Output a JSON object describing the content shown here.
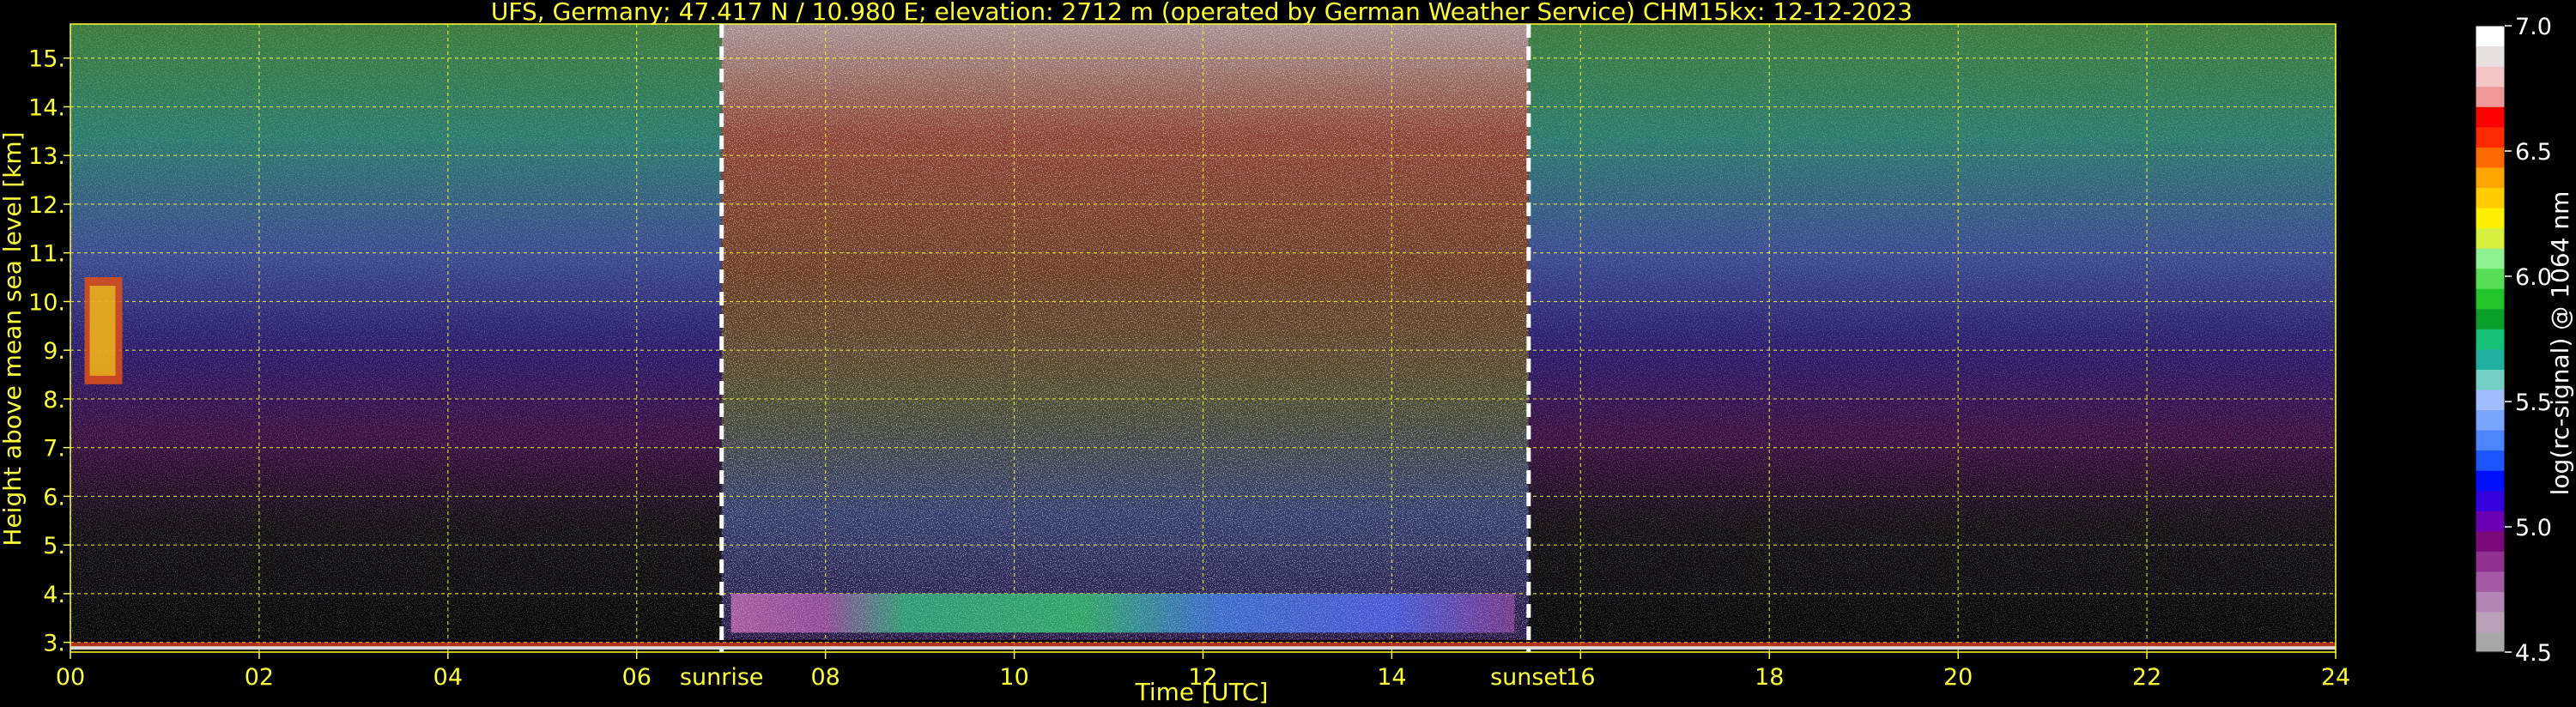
{
  "chart_data": {
    "type": "heatmap",
    "title": "UFS, Germany; 47.417 N / 10.980 E; elevation: 2712 m  (operated by German Weather Service)    CHM15kx: 12-12-2023",
    "xlabel": "Time [UTC]",
    "ylabel": "Height above mean sea level [km]",
    "xlim": [
      0,
      24
    ],
    "ylim": [
      2.8,
      15.7
    ],
    "x_ticks": [
      0,
      2,
      4,
      6,
      8,
      10,
      12,
      14,
      16,
      18,
      20,
      22,
      24
    ],
    "x_tick_labels": [
      "00",
      "02",
      "04",
      "06",
      "08",
      "10",
      "12",
      "14",
      "16",
      "18",
      "20",
      "22",
      "24"
    ],
    "y_ticks": [
      3,
      4,
      5,
      6,
      7,
      8,
      9,
      10,
      11,
      12,
      13,
      14,
      15
    ],
    "y_tick_labels": [
      "3.",
      "4.",
      "5.",
      "6.",
      "7.",
      "8.",
      "9.",
      "10.",
      "11.",
      "12.",
      "13.",
      "14.",
      "15."
    ],
    "grid": true,
    "grid_color": "#ffff33",
    "axis_label_color": "#ffff33",
    "annotations": [
      {
        "text": "sunrise",
        "x": 6.9
      },
      {
        "text": "sunset",
        "x": 15.45
      }
    ],
    "colorbar": {
      "label": "log(rc-signal) @ 1064 nm",
      "range": [
        4.5,
        7.0
      ],
      "tick_values": [
        4.5,
        5.0,
        5.5,
        6.0,
        6.5,
        7.0
      ],
      "tick_labels": [
        "4.5",
        "5.0",
        "5.5",
        "6.0",
        "6.5",
        "7.0"
      ],
      "colors": [
        "#a7a7a7",
        "#b9a0b9",
        "#b184b1",
        "#a45aa4",
        "#903090",
        "#7a0a7a",
        "#6b00b3",
        "#3300dd",
        "#0010ff",
        "#1d55ff",
        "#4d85ff",
        "#7aa5ff",
        "#a0bdff",
        "#74d0c4",
        "#1faf9f",
        "#18c17a",
        "#0a9e2a",
        "#21c42a",
        "#55dd55",
        "#8ef08e",
        "#d8f040",
        "#fff000",
        "#ffcc00",
        "#ffa500",
        "#ff6a00",
        "#ff2a00",
        "#ff0000",
        "#ee9999",
        "#f2c4c4",
        "#e8e0e0",
        "#ffffff"
      ]
    },
    "features": [
      {
        "kind": "night_background",
        "x": [
          0,
          6.9
        ]
      },
      {
        "kind": "daylight_noise",
        "x": [
          6.9,
          15.45
        ]
      },
      {
        "kind": "night_background",
        "x": [
          15.45,
          24
        ]
      },
      {
        "kind": "cloud_layer",
        "x": [
          0.15,
          0.55
        ],
        "y": [
          8.3,
          10.5
        ]
      },
      {
        "kind": "boundary_layer",
        "x": [
          7.0,
          15.3
        ],
        "y": [
          3.2,
          4.0
        ]
      }
    ]
  }
}
